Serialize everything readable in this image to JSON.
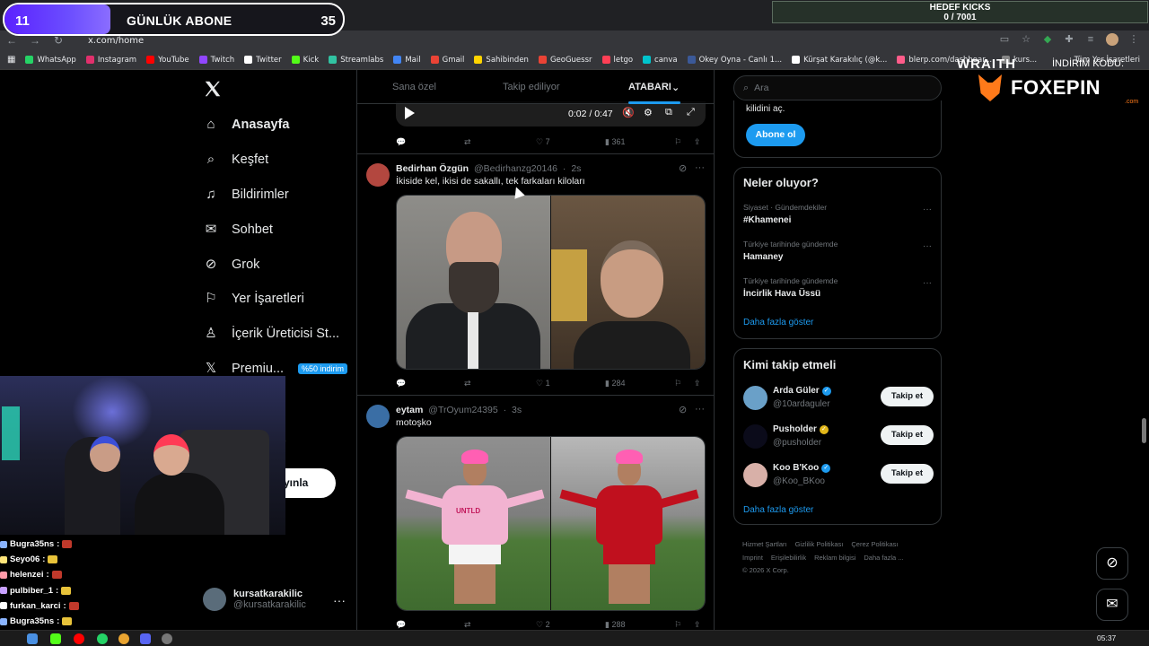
{
  "overlay": {
    "sub_goal": {
      "current": "11",
      "title": "GÜNLÜK ABONE",
      "target": "35",
      "fill_ratio": 0.314
    },
    "kicks": {
      "title": "HEDEF KICKS",
      "progress": "0 / 7001"
    },
    "sponsor": {
      "wraith": "WRAITH",
      "discount": "İNDİRİM KODU:",
      "brand": "FOXEPIN",
      "tld": ".com"
    },
    "chat": [
      {
        "user": "Bugra35ns",
        "color": "#8ab4ff"
      },
      {
        "user": "Seyo06",
        "color": "#ffe57a"
      },
      {
        "user": "helenzei",
        "color": "#ff9aa8"
      },
      {
        "user": "pulbiber_1",
        "color": "#c8a0ff"
      },
      {
        "user": "furkan_karci",
        "color": "#ffffff"
      },
      {
        "user": "Bugra35ns",
        "color": "#8ab4ff"
      }
    ],
    "chat_sep": ":"
  },
  "browser": {
    "url": "x.com/home",
    "bookmarks": [
      "WhatsApp",
      "Instagram",
      "YouTube",
      "Twitch",
      "Twitter",
      "Kick",
      "Streamlabs",
      "Mail",
      "Gmail",
      "Sahibinden",
      "GeoGuessr",
      "letgo",
      "canva",
      "Okey Oyna - Canlı 1...",
      "Kürşat Karakılıç (@k...",
      "blerp.com/dashboar...",
      "kurs..."
    ],
    "bookmark_colors": [
      "#25d366",
      "#e1306c",
      "#ff0000",
      "#9146ff",
      "#ffffff",
      "#53fc18",
      "#31c3a2",
      "#4285f4",
      "#ea4335",
      "#ffd400",
      "#ea4335",
      "#ff3f55",
      "#00c4cc",
      "#3b5998",
      "#ffffff",
      "#ff5c8a",
      "#888888"
    ],
    "bookmarks_right": "Tüm Yer İşaretleri"
  },
  "nav": {
    "items": [
      {
        "label": "Anasayfa",
        "icon": "⌂"
      },
      {
        "label": "Keşfet",
        "icon": "⌕"
      },
      {
        "label": "Bildirimler",
        "icon": "♫"
      },
      {
        "label": "Sohbet",
        "icon": "✉"
      },
      {
        "label": "Grok",
        "icon": "⊘"
      },
      {
        "label": "Yer İşaretleri",
        "icon": "⚐"
      },
      {
        "label": "İçerik Üreticisi St...",
        "icon": "♙"
      },
      {
        "label": "Premiu...",
        "icon": "𝕏"
      }
    ],
    "premium_badge": "%50 indirim",
    "more_partial": "a",
    "publish_label": "yınla",
    "profile": {
      "name": "kursatkarakilic",
      "handle": "@kursatkarakilic"
    }
  },
  "feed": {
    "tabs": [
      "Sana özel",
      "Takip ediliyor",
      "ATABARI"
    ],
    "video": {
      "time": "0:02 / 0:47"
    },
    "top_post_stats": {
      "likes": "7",
      "views": "361"
    },
    "posts": [
      {
        "name": "Bedirhan Özgün",
        "handle": "@Bedirhanzg20146",
        "time": "2s",
        "text": "İkiside kel, ikisi de sakallı, tek farkaları kiloları",
        "likes": "1",
        "views": "284"
      },
      {
        "name": "eytam",
        "handle": "@TrOyum24395",
        "time": "3s",
        "text": "motoşko",
        "likes": "2",
        "views": "288"
      }
    ],
    "jersey_text": "UNTLD"
  },
  "right": {
    "search_placeholder": "Ara",
    "premium": {
      "text": "kilidini aç.",
      "button": "Abone ol"
    },
    "trends": {
      "title": "Neler oluyor?",
      "items": [
        {
          "context": "Siyaset · Gündemdekiler",
          "name": "#Khamenei"
        },
        {
          "context": "Türkiye tarihinde gündemde",
          "name": "Hamaney"
        },
        {
          "context": "Türkiye tarihinde gündemde",
          "name": "İncirlik Hava Üssü"
        }
      ],
      "more": "Daha fazla göster"
    },
    "follow": {
      "title": "Kimi takip etmeli",
      "items": [
        {
          "name": "Arda Güler",
          "handle": "@10ardaguler",
          "verified": "blue",
          "avatar": "#6aa0c8"
        },
        {
          "name": "Pusholder",
          "handle": "@pusholder",
          "verified": "gold",
          "avatar": "#0b0b1a"
        },
        {
          "name": "Koo B'Koo",
          "handle": "@Koo_BKoo",
          "verified": "blue",
          "avatar": "#d8b0a8"
        }
      ],
      "button": "Takip et",
      "more": "Daha fazla göster"
    },
    "footer": [
      "Hizmet Şartları",
      "Gizlilik Politikası",
      "Çerez Politikası",
      "Imprint",
      "Erişilebilirlik",
      "Reklam bilgisi",
      "Daha fazla ...",
      "© 2026 X Corp."
    ]
  },
  "taskbar": {
    "time": "05:37"
  }
}
